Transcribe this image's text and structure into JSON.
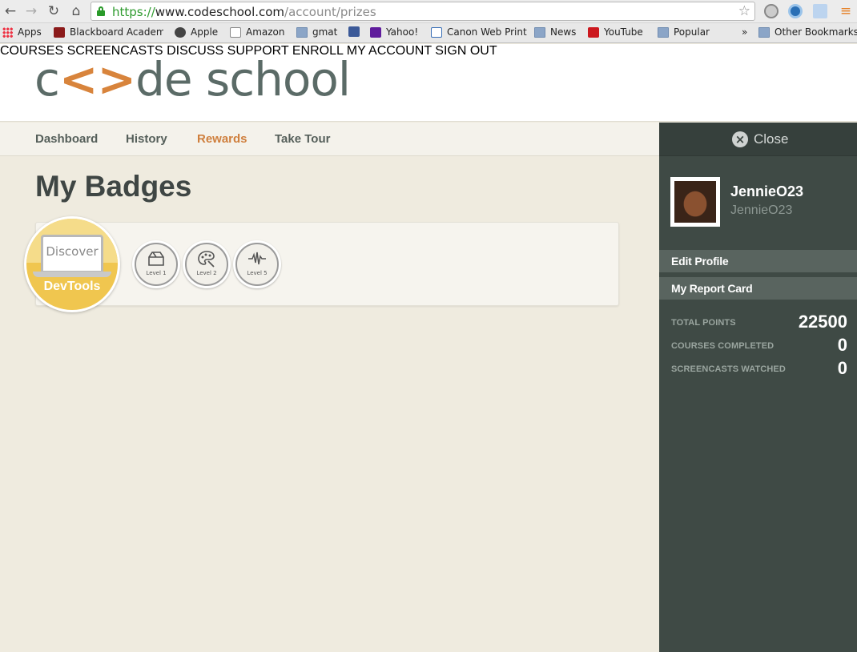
{
  "browser": {
    "url_scheme": "https://",
    "url_host": "www.codeschool.com",
    "url_path": "/account/prizes",
    "bookmarks": [
      {
        "label": "Apps",
        "icon": "apps-grid-icon"
      },
      {
        "label": "Blackboard Academi",
        "icon": "blackboard-icon"
      },
      {
        "label": "Apple",
        "icon": "apple-icon"
      },
      {
        "label": "Amazon",
        "icon": "amazon-icon"
      },
      {
        "label": "gmat",
        "icon": "folder-icon"
      },
      {
        "label": "Yahoo!",
        "icon": "yahoo-icon"
      },
      {
        "label": "Canon Web Print",
        "icon": "canon-icon"
      },
      {
        "label": "News",
        "icon": "folder-icon"
      },
      {
        "label": "YouTube",
        "icon": "youtube-icon"
      },
      {
        "label": "Popular",
        "icon": "folder-icon"
      },
      {
        "label": "»",
        "icon": ""
      },
      {
        "label": "Other Bookmarks",
        "icon": "folder-icon"
      }
    ]
  },
  "site": {
    "logo_left": "c",
    "logo_brackets": "<>",
    "logo_right": "de school",
    "nav": [
      "COURSES",
      "SCREENCASTS",
      "DISCUSS",
      "SUPPORT",
      "ENROLL",
      "MY ACCOUNT",
      "SIGN OUT"
    ]
  },
  "subnav": [
    "Dashboard",
    "History",
    "Rewards",
    "Take Tour"
  ],
  "page_title": "My Badges",
  "badges": {
    "main": {
      "top": "Discover",
      "bottom": "DevTools"
    },
    "levels": [
      {
        "label": "Level 1",
        "icon": "inbox-icon"
      },
      {
        "label": "Level 2",
        "icon": "palette-icon"
      },
      {
        "label": "Level 5",
        "icon": "waveform-icon"
      }
    ]
  },
  "panel": {
    "close_label": "Close",
    "username": "JennieO23",
    "handle": "JennieO23",
    "links": [
      "Edit Profile",
      "My Report Card"
    ],
    "stats": [
      {
        "label": "TOTAL POINTS",
        "value": "22500"
      },
      {
        "label": "COURSES COMPLETED",
        "value": "0"
      },
      {
        "label": "SCREENCASTS WATCHED",
        "value": "0"
      }
    ]
  },
  "colors": {
    "accent": "#cf7f3d",
    "panel_bg": "#3f4a45",
    "badge_gold": "#f0c64f"
  }
}
